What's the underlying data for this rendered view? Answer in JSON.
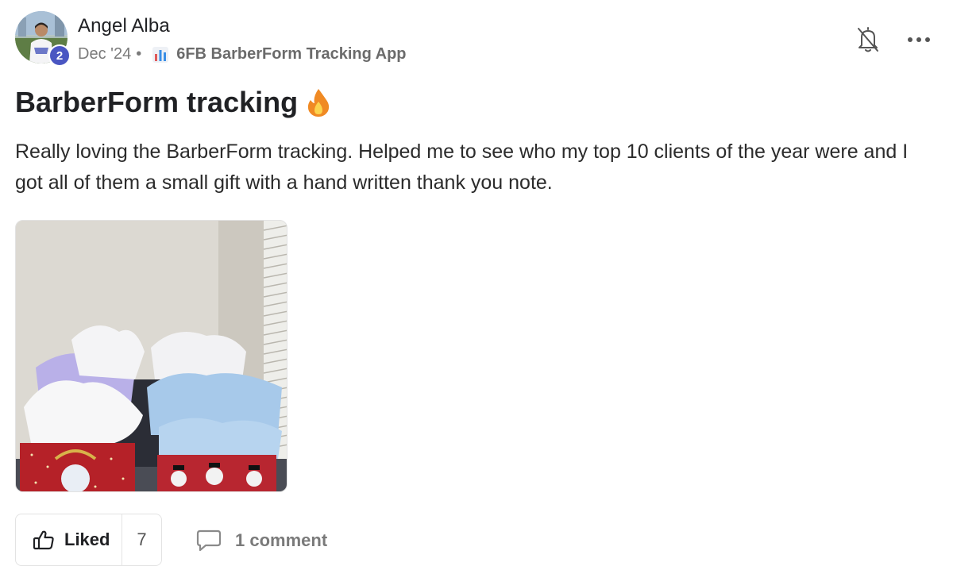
{
  "author": {
    "name": "Angel Alba",
    "level": "2"
  },
  "meta": {
    "date": "Dec '24",
    "separator": "•",
    "category": "6FB BarberForm Tracking App"
  },
  "post": {
    "title": "BarberForm tracking",
    "body": "Really loving the BarberForm tracking. Helped me to see who my top 10 clients of the year were and I got all of them a small gift with a hand written thank you note."
  },
  "actions": {
    "like_label": "Liked",
    "like_count": "7",
    "comment_label": "1 comment"
  },
  "icons": {
    "bell": "bell-off-icon",
    "more": "more-horizontal-icon",
    "category": "bar-chart-icon",
    "title_emoji": "fire-icon",
    "like": "thumbs-up-icon",
    "comment": "comment-icon"
  },
  "colors": {
    "level_badge": "#4a56c2",
    "flame": "#f08a24",
    "text": "#202124",
    "muted": "#7a7a7a"
  }
}
